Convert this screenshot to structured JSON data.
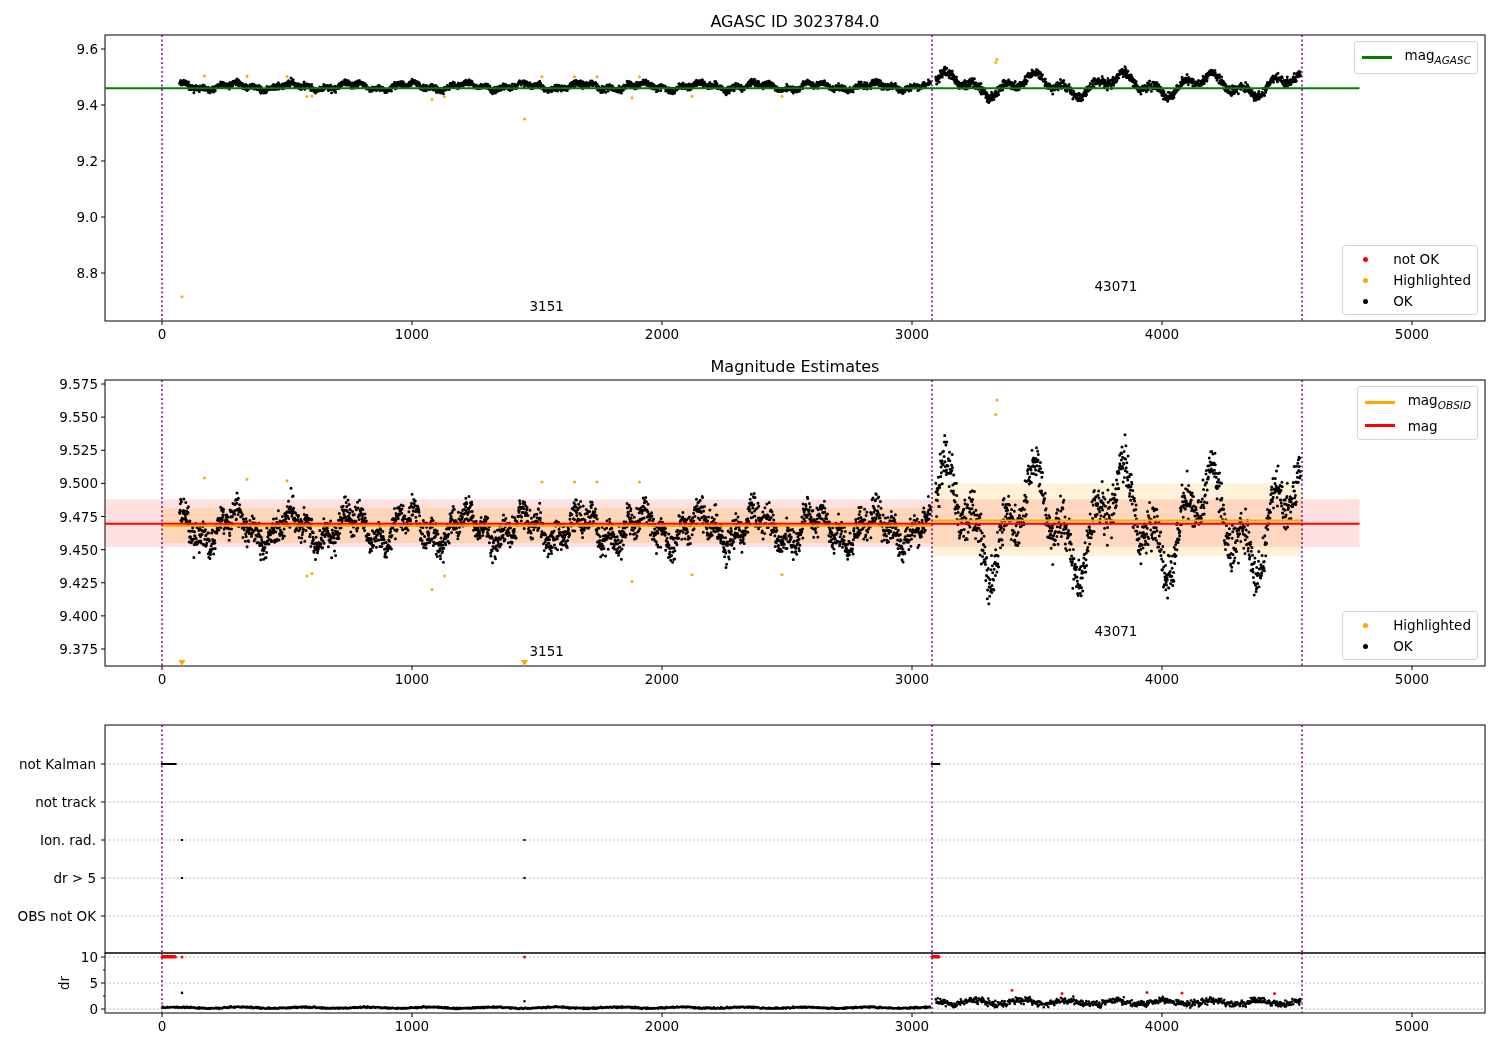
{
  "figure": {
    "panels": [
      {
        "kind": "magnitude",
        "title": "AGASC ID 3023784.0",
        "xticks": [
          "0",
          "1000",
          "2000",
          "3000",
          "4000",
          "5000"
        ],
        "yticks": [
          "9.6",
          "9.4",
          "9.2",
          "9.0",
          "8.8"
        ],
        "legends": [
          {
            "entries": [
              {
                "kind": "line",
                "color": "#008000",
                "label": "mag$_{AGASC}$"
              }
            ]
          },
          {
            "entries": [
              {
                "kind": "dot",
                "color": "#ff0000",
                "label": "not OK"
              },
              {
                "kind": "dot",
                "color": "#ffa500",
                "label": "Highlighted"
              },
              {
                "kind": "dot",
                "color": "#000000",
                "label": "OK"
              }
            ]
          }
        ],
        "annotations": [
          "3151",
          "43071"
        ]
      },
      {
        "kind": "estimates",
        "title": "Magnitude Estimates",
        "xticks": [
          "0",
          "1000",
          "2000",
          "3000",
          "4000",
          "5000"
        ],
        "yticks": [
          "9.575",
          "9.550",
          "9.525",
          "9.500",
          "9.475",
          "9.450",
          "9.425",
          "9.400",
          "9.375"
        ],
        "legends": [
          {
            "entries": [
              {
                "kind": "line",
                "color": "#ffa500",
                "label": "mag$_{OBSID}$"
              },
              {
                "kind": "line",
                "color": "#ff0000",
                "label": "mag"
              }
            ]
          },
          {
            "entries": [
              {
                "kind": "dot",
                "color": "#ffa500",
                "label": "Highlighted"
              },
              {
                "kind": "dot",
                "color": "#000000",
                "label": "OK"
              }
            ]
          }
        ],
        "annotations": [
          "3151",
          "43071"
        ]
      },
      {
        "kind": "flags",
        "categories": [
          "not Kalman",
          "not track",
          "Ion. rad.",
          "dr > 5",
          "OBS not OK"
        ]
      },
      {
        "kind": "dr",
        "ylabel": "dr",
        "yticks": [
          "10",
          "5",
          "0"
        ],
        "xticks": [
          "0",
          "1000",
          "2000",
          "3000",
          "4000",
          "5000"
        ]
      }
    ]
  }
}
